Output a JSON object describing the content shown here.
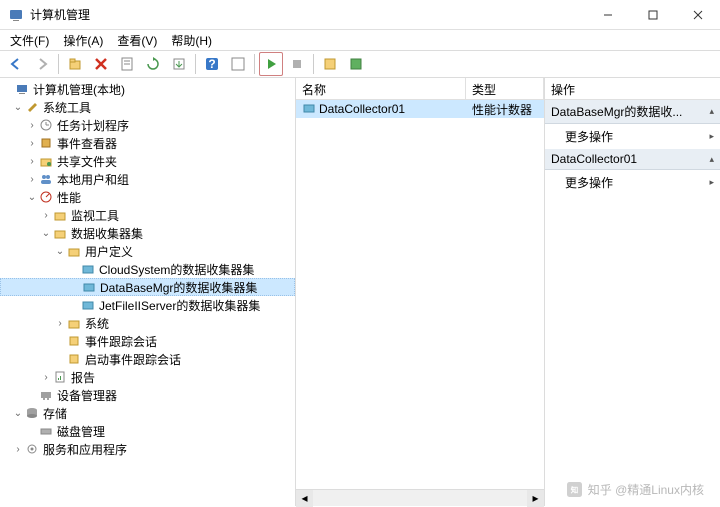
{
  "window": {
    "title": "计算机管理"
  },
  "menu": {
    "file": "文件(F)",
    "action": "操作(A)",
    "view": "查看(V)",
    "help": "帮助(H)"
  },
  "tree": {
    "root": "计算机管理(本地)",
    "systools": "系统工具",
    "scheduler": "任务计划程序",
    "eventviewer": "事件查看器",
    "shared": "共享文件夹",
    "users": "本地用户和组",
    "perf": "性能",
    "monitor": "监视工具",
    "dcs": "数据收集器集",
    "userdef": "用户定义",
    "dcs1": "CloudSystem的数据收集器集",
    "dcs2": "DataBaseMgr的数据收集器集",
    "dcs3": "JetFileIIServer的数据收集器集",
    "system": "系统",
    "trace": "事件跟踪会话",
    "starttrace": "启动事件跟踪会话",
    "reports": "报告",
    "devmgr": "设备管理器",
    "storage": "存储",
    "diskmgr": "磁盘管理",
    "services": "服务和应用程序"
  },
  "columns": {
    "name": "名称",
    "type": "类型"
  },
  "list": {
    "items": [
      {
        "name": "DataCollector01",
        "type": "性能计数器"
      }
    ]
  },
  "actions": {
    "header": "操作",
    "group1": "DataBaseMgr的数据收...",
    "more1": "更多操作",
    "group2": "DataCollector01",
    "more2": "更多操作"
  },
  "watermark": "知乎 @精通Linux内核"
}
